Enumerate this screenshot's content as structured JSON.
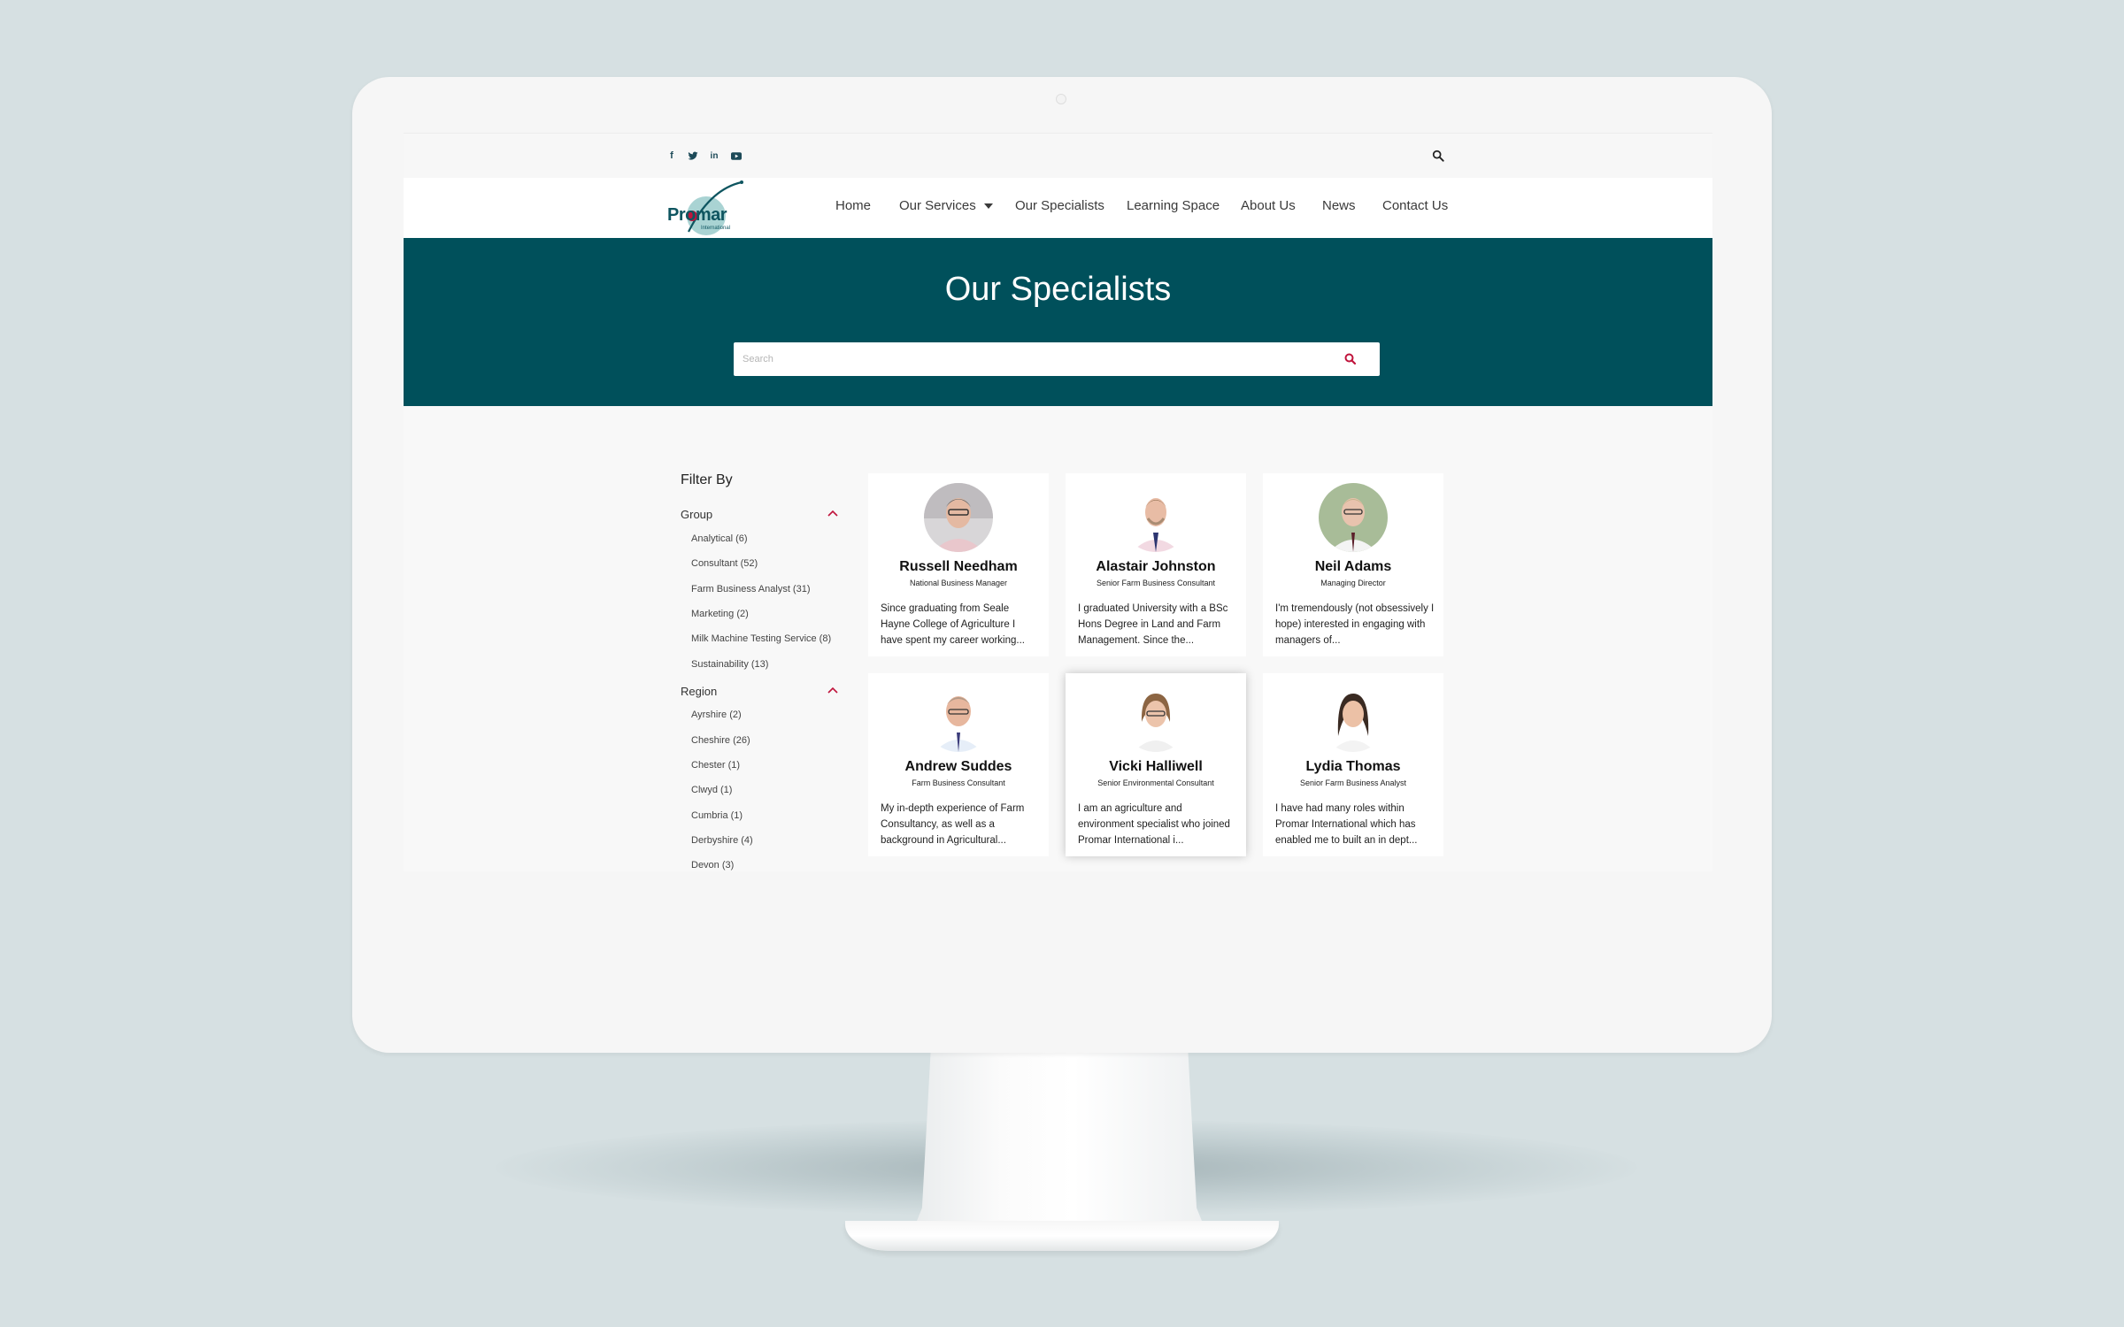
{
  "top_bar": {
    "social": [
      {
        "name": "facebook-icon",
        "glyph": "f"
      },
      {
        "name": "twitter-icon",
        "glyph": "t"
      },
      {
        "name": "linkedin-icon",
        "glyph": "in"
      },
      {
        "name": "youtube-icon",
        "glyph": "▶"
      }
    ]
  },
  "brand": {
    "logo_text": "Promar",
    "logo_sub": "International"
  },
  "nav": {
    "home": "Home",
    "our_services": "Our Services",
    "our_specialists": "Our Specialists",
    "learning_space": "Learning Space",
    "about_us": "About Us",
    "news": "News",
    "contact_us": "Contact Us"
  },
  "hero": {
    "title": "Our Specialists",
    "search_placeholder": "Search"
  },
  "filters": {
    "title": "Filter By",
    "group": {
      "label": "Group",
      "options": [
        "Analytical (6)",
        "Consultant (52)",
        "Farm Business Analyst (31)",
        "Marketing (2)",
        "Milk Machine Testing Service (8)",
        "Sustainability (13)"
      ]
    },
    "region": {
      "label": "Region",
      "options": [
        "Ayrshire (2)",
        "Cheshire (26)",
        "Chester (1)",
        "Clwyd (1)",
        "Cumbria (1)",
        "Derbyshire (4)",
        "Devon (3)"
      ]
    }
  },
  "specialists": [
    {
      "name": "Russell Needham",
      "role": "National Business Manager",
      "bio": "Since graduating from Seale Hayne College of Agriculture I have spent my career working..."
    },
    {
      "name": "Alastair Johnston",
      "role": "Senior Farm Business Consultant",
      "bio": "I graduated University with a BSc Hons Degree in Land and Farm Management. Since the..."
    },
    {
      "name": "Neil Adams",
      "role": "Managing Director",
      "bio": "I'm tremendously (not obsessively I hope) interested in engaging with managers of..."
    },
    {
      "name": "Andrew Suddes",
      "role": "Farm Business Consultant",
      "bio": "My in-depth experience of Farm Consultancy, as well as a background in Agricultural..."
    },
    {
      "name": "Vicki Halliwell",
      "role": "Senior Environmental Consultant",
      "bio": "I am an agriculture and environment specialist who joined Promar International i..."
    },
    {
      "name": "Lydia Thomas",
      "role": "Senior Farm Business Analyst",
      "bio": "I have had many roles within Promar International which has enabled me to built an in dept..."
    }
  ],
  "colors": {
    "brand_teal": "#00505b",
    "accent_red": "#c0143c"
  }
}
